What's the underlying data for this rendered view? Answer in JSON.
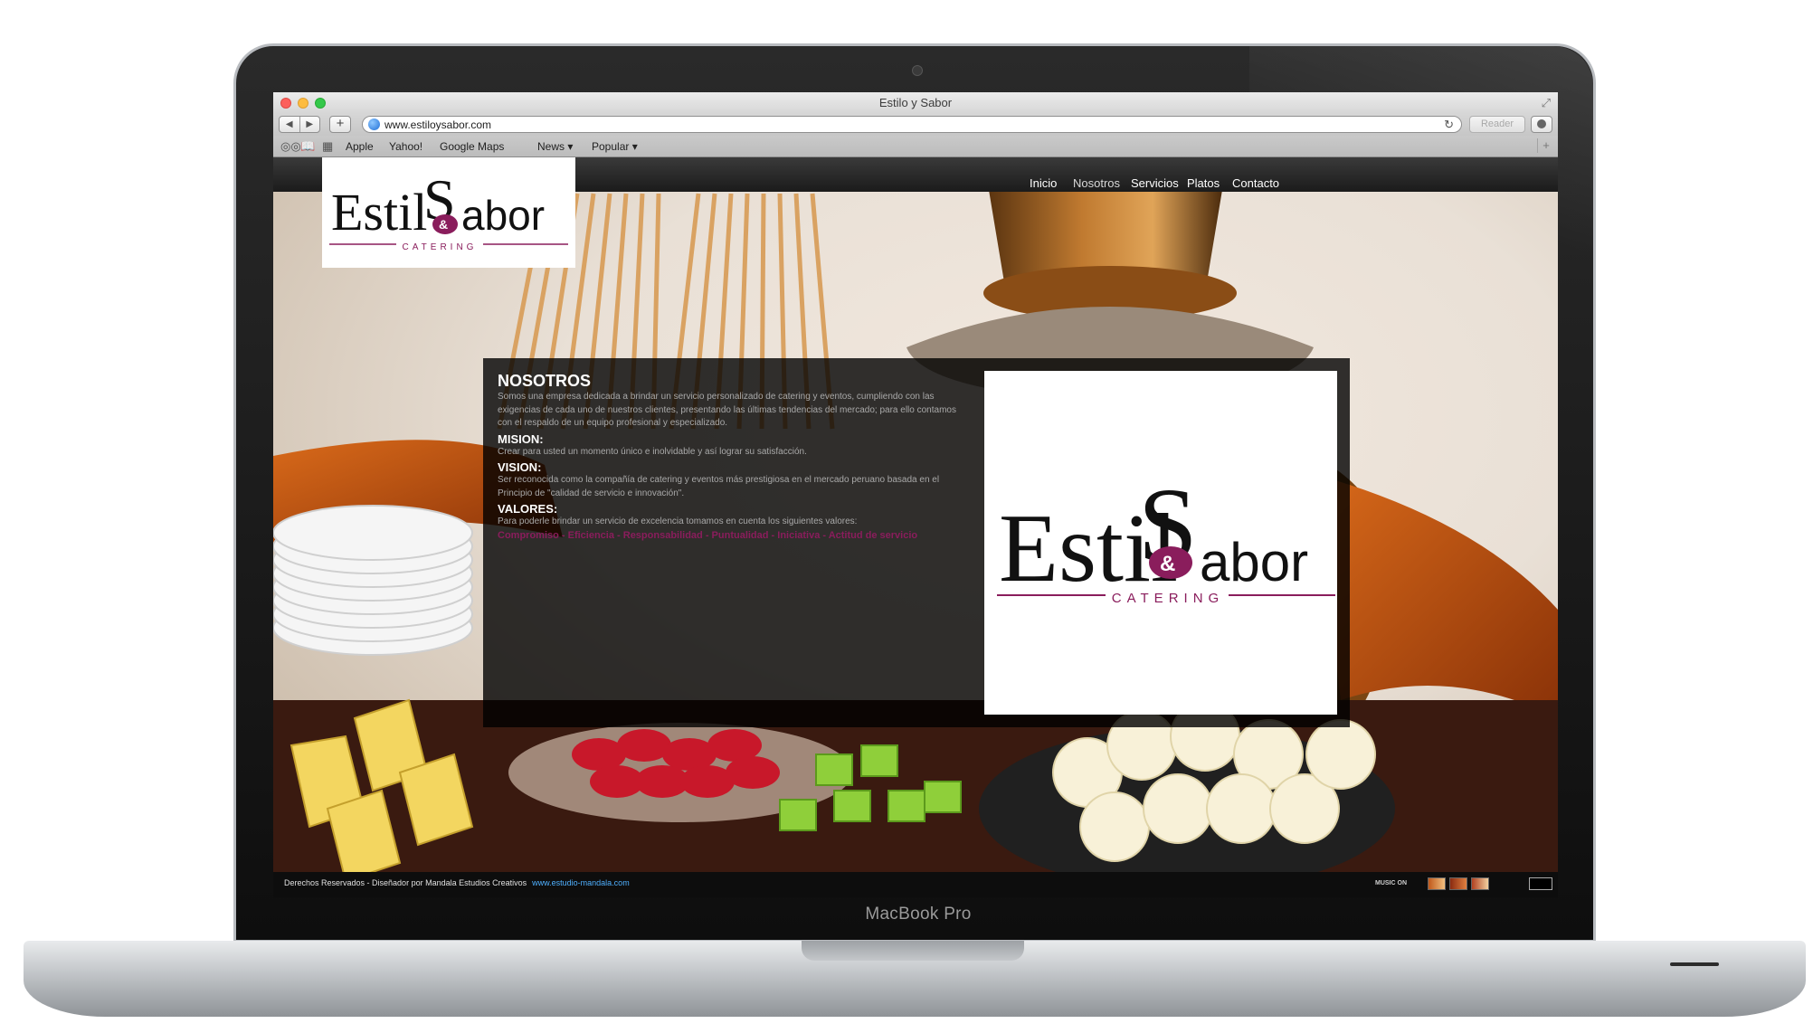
{
  "device": {
    "model_label": "MacBook Pro"
  },
  "browser": {
    "window_title": "Estilo y Sabor",
    "url": "www.estiloysabor.com",
    "reader_label": "Reader",
    "bookmarks": [
      "Apple",
      "Yahoo!",
      "Google Maps",
      "News ▾",
      "Popular ▾"
    ]
  },
  "site": {
    "brand": {
      "part1": "Estil",
      "ampersand": "&",
      "part2": "abor",
      "s_letter": "S",
      "tagline": "CATERING"
    },
    "nav": [
      "Inicio",
      "Nosotros",
      "Servicios",
      "Platos",
      "Contacto"
    ],
    "nav_active": "Nosotros",
    "about": {
      "title": "NOSOTROS",
      "intro": "Somos una empresa dedicada a brindar un servicio personalizado de catering y eventos, cumpliendo con las exigencias de cada  uno de nuestros clientes, presentando las últimas tendencias del mercado; para ello contamos con el respaldo de un equipo profesional y especializado.",
      "mision_label": "MISION:",
      "mision_text": " Crear para usted un momento único e inolvidable y así  lograr su satisfacción.",
      "vision_label": "VISION:",
      "vision_text": "Ser reconocida como la compañía de catering y eventos más prestigiosa en el mercado peruano basada en el Principio de \"calidad de servicio e innovación\".",
      "valores_label": "VALORES:",
      "valores_text": "Para poderle brindar un servicio de excelencia tomamos en cuenta los siguientes valores:",
      "valores_list": "Compromiso - Eficiencia - Responsabilidad - Puntualidad - Iniciativa - Actitud de servicio"
    },
    "footer": {
      "copyright": "Derechos Reservados - Diseñador por Mandala Estudios Creativos",
      "credit_link": "www.estudio-mandala.com",
      "music_label": "MUSIC ON"
    }
  },
  "colors": {
    "brand_magenta": "#8a1d5c",
    "link_blue": "#4fb0ff",
    "panel_bg": "#000000cc"
  },
  "icons": [
    "back-icon",
    "forward-icon",
    "add-icon",
    "globe-icon",
    "reload-icon",
    "download-icon",
    "reading-list-icon",
    "bookmarks-icon",
    "top-sites-icon",
    "fullscreen-icon"
  ]
}
